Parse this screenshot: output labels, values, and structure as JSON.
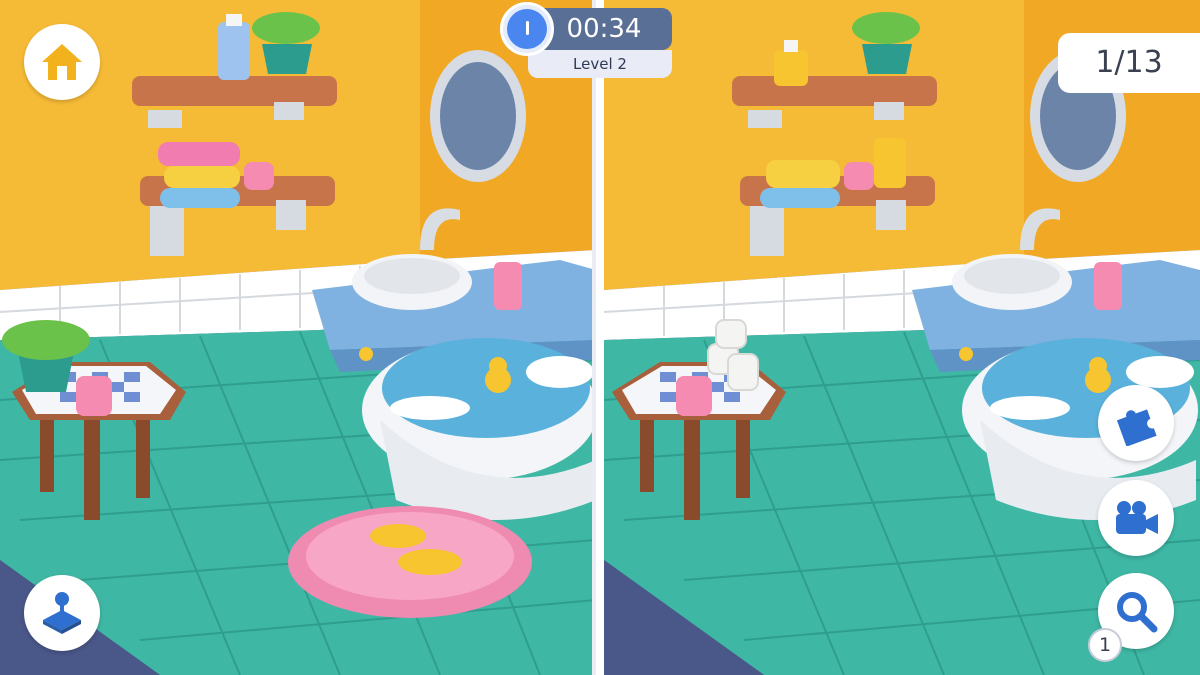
{
  "hud": {
    "timer": "00:34",
    "level": "Level 2",
    "found_counter": "1/13",
    "hint_count": "1"
  },
  "buttons": {
    "home": "home-icon",
    "joystick": "joystick-icon",
    "puzzle": "puzzle-icon",
    "video": "video-camera-icon",
    "magnifier": "magnifier-icon",
    "timer": "clock-icon"
  },
  "colors": {
    "accent": "#4a86f0",
    "home_icon": "#f2b21e",
    "wall": "#f6bb36",
    "floor": "#3fb7a5",
    "tile": "#ffffff",
    "timer_pill": "#5a6f96"
  }
}
